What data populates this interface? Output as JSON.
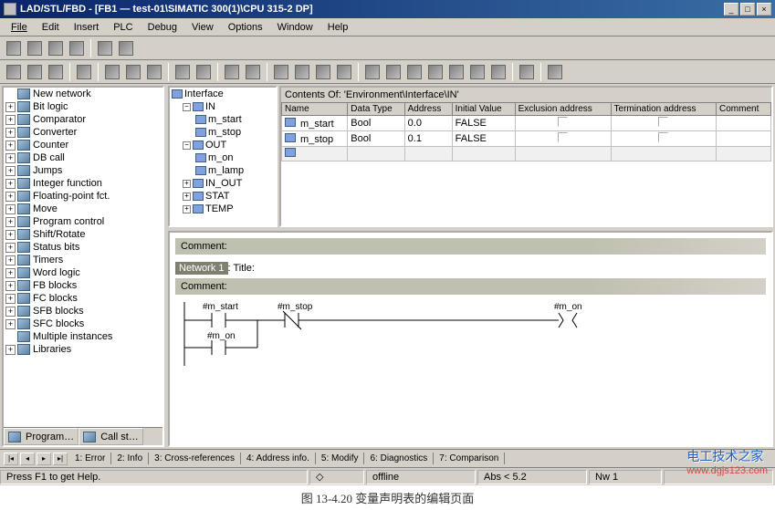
{
  "window": {
    "title": "LAD/STL/FBD  -  [FB1  —  test-01\\SIMATIC 300(1)\\CPU 315-2 DP]"
  },
  "menu": [
    "File",
    "Edit",
    "Insert",
    "PLC",
    "Debug",
    "View",
    "Options",
    "Window",
    "Help"
  ],
  "left_tree": [
    {
      "exp": "",
      "label": "New network"
    },
    {
      "exp": "+",
      "label": "Bit logic"
    },
    {
      "exp": "+",
      "label": "Comparator"
    },
    {
      "exp": "+",
      "label": "Converter"
    },
    {
      "exp": "+",
      "label": "Counter"
    },
    {
      "exp": "+",
      "label": "DB call"
    },
    {
      "exp": "+",
      "label": "Jumps"
    },
    {
      "exp": "+",
      "label": "Integer function"
    },
    {
      "exp": "+",
      "label": "Floating-point fct."
    },
    {
      "exp": "+",
      "label": "Move"
    },
    {
      "exp": "+",
      "label": "Program control"
    },
    {
      "exp": "+",
      "label": "Shift/Rotate"
    },
    {
      "exp": "+",
      "label": "Status bits"
    },
    {
      "exp": "+",
      "label": "Timers"
    },
    {
      "exp": "+",
      "label": "Word logic"
    },
    {
      "exp": "+",
      "label": "FB blocks"
    },
    {
      "exp": "+",
      "label": "FC blocks"
    },
    {
      "exp": "+",
      "label": "SFB blocks"
    },
    {
      "exp": "+",
      "label": "SFC blocks"
    },
    {
      "exp": "",
      "label": "Multiple instances"
    },
    {
      "exp": "+",
      "label": "Libraries"
    }
  ],
  "left_tabs": {
    "program": "Program…",
    "call": "Call st…"
  },
  "contents_of": "Contents Of: 'Environment\\Interface\\IN'",
  "iface_tree": {
    "root": "Interface",
    "in": "IN",
    "in_items": [
      "m_start",
      "m_stop"
    ],
    "out": "OUT",
    "out_items": [
      "m_on",
      "m_lamp"
    ],
    "in_out": "IN_OUT",
    "stat": "STAT",
    "temp": "TEMP"
  },
  "var_headers": [
    "Name",
    "Data Type",
    "Address",
    "Initial Value",
    "Exclusion address",
    "Termination address",
    "Comment"
  ],
  "var_rows": [
    {
      "name": "m_start",
      "type": "Bool",
      "addr": "0.0",
      "init": "FALSE"
    },
    {
      "name": "m_stop",
      "type": "Bool",
      "addr": "0.1",
      "init": "FALSE"
    }
  ],
  "editor": {
    "comment": "Comment:",
    "network": "Network 1",
    "title_sep": ": Title:",
    "lad": {
      "v1": "#m_start",
      "v2": "#m_stop",
      "v3": "#m_on",
      "v4": "#m_on"
    }
  },
  "bottom_tabs": [
    "1: Error",
    "2: Info",
    "3: Cross-references",
    "4: Address info.",
    "5: Modify",
    "6: Diagnostics",
    "7: Comparison"
  ],
  "status": {
    "help": "Press F1 to get Help.",
    "offline": "offline",
    "abs": "Abs < 5.2",
    "nw": "Nw 1"
  },
  "caption": "图 13-4.20  变量声明表的编辑页面",
  "watermark": {
    "cn": "电工技术之家",
    "url": "www.dgjs123.com"
  }
}
